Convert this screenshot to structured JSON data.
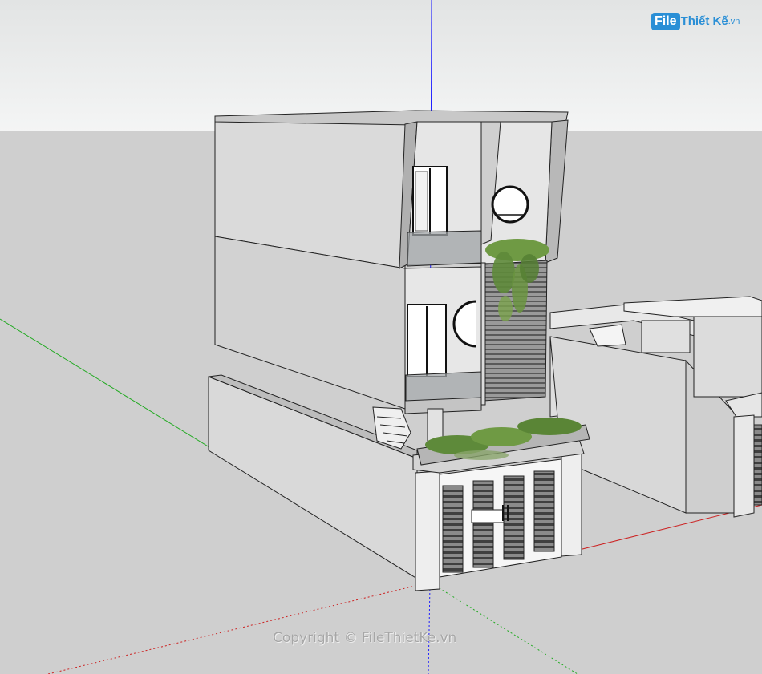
{
  "watermark": {
    "logo_badge": "File",
    "logo_rest": "Thiết Kế",
    "logo_tld": ".vn",
    "copyright": "Copyright © FileThietKe.vn"
  },
  "colors": {
    "sky": "#eef0f0",
    "ground": "#cfcfcf",
    "wall_light": "#ececec",
    "wall_mid": "#d6d6d6",
    "wall_dark": "#bdbdbd",
    "axis_blue": "#2020ff",
    "axis_green": "#22aa22",
    "axis_red": "#cc2222",
    "greenery": "#5e8a3a"
  }
}
